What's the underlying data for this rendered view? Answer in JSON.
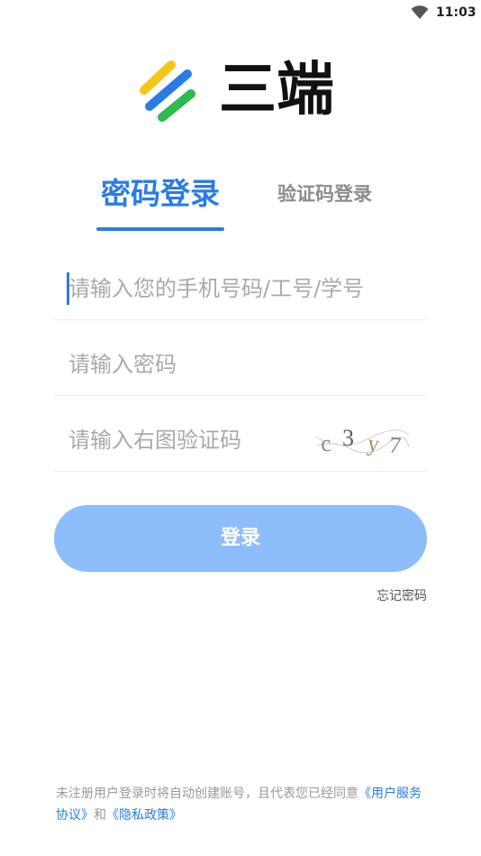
{
  "status_bar": {
    "time": "11:03",
    "wifi_icon": "wifi-icon"
  },
  "logo": {
    "text": "三端",
    "colors": [
      "#f5c518",
      "#2c7be5",
      "#2dba4e"
    ]
  },
  "tabs": {
    "password_login": "密码登录",
    "code_login": "验证码登录",
    "active_color": "#2c7be5"
  },
  "form": {
    "phone_placeholder": "请输入您的手机号码/工号/学号",
    "password_placeholder": "请输入密码",
    "captcha_placeholder": "请输入右图验证码",
    "captcha_chars": [
      "c",
      "3",
      "y",
      "7"
    ]
  },
  "login_button": {
    "label": "登录",
    "color": "#8dbdfb"
  },
  "forgot_password": "忘记密码",
  "footer": {
    "text": "未注册用户登录时将自动创建账号，且代表您已经同意",
    "user_agreement": "《用户服务协议》",
    "and": "和",
    "privacy_policy": "《隐私政策》"
  }
}
